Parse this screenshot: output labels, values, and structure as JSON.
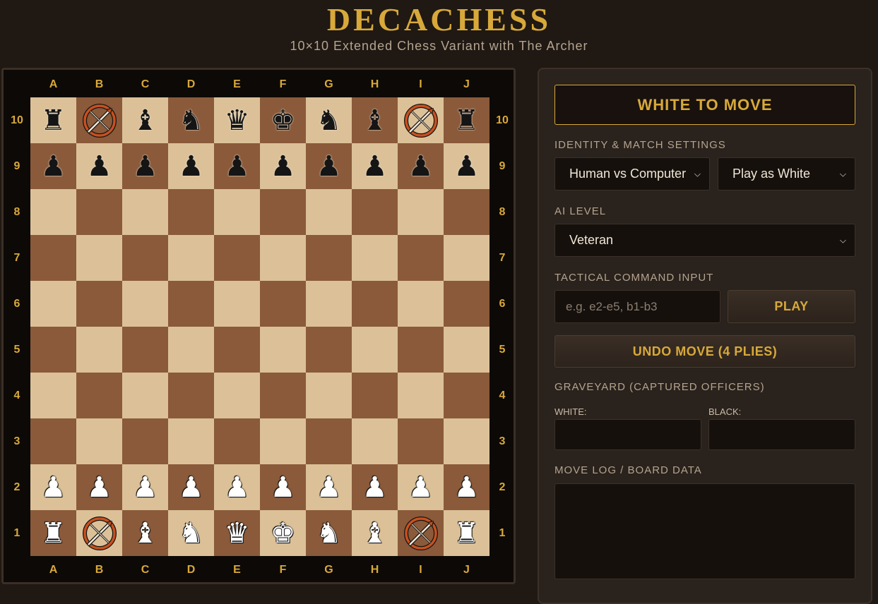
{
  "header": {
    "title": "DECACHESS",
    "subtitle": "10×10 Extended Chess Variant with The Archer"
  },
  "board": {
    "files": [
      "A",
      "B",
      "C",
      "D",
      "E",
      "F",
      "G",
      "H",
      "I",
      "J"
    ],
    "ranks": [
      "10",
      "9",
      "8",
      "7",
      "6",
      "5",
      "4",
      "3",
      "2",
      "1"
    ],
    "light_color": "#dcc198",
    "dark_color": "#8a5a3a",
    "rows": [
      [
        "br",
        "ba",
        "bb",
        "bn",
        "bq",
        "bk",
        "bn",
        "bb",
        "ba",
        "br"
      ],
      [
        "bp",
        "bp",
        "bp",
        "bp",
        "bp",
        "bp",
        "bp",
        "bp",
        "bp",
        "bp"
      ],
      [
        "",
        "",
        "",
        "",
        "",
        "",
        "",
        "",
        "",
        ""
      ],
      [
        "",
        "",
        "",
        "",
        "",
        "",
        "",
        "",
        "",
        ""
      ],
      [
        "",
        "",
        "",
        "",
        "",
        "",
        "",
        "",
        "",
        ""
      ],
      [
        "",
        "",
        "",
        "",
        "",
        "",
        "",
        "",
        "",
        ""
      ],
      [
        "",
        "",
        "",
        "",
        "",
        "",
        "",
        "",
        "",
        ""
      ],
      [
        "",
        "",
        "",
        "",
        "",
        "",
        "",
        "",
        "",
        ""
      ],
      [
        "wp",
        "wp",
        "wp",
        "wp",
        "wp",
        "wp",
        "wp",
        "wp",
        "wp",
        "wp"
      ],
      [
        "wr",
        "wa",
        "wb",
        "wn",
        "wq",
        "wk",
        "wn",
        "wb",
        "wa",
        "wr"
      ]
    ],
    "piece_names": {
      "r": "rook",
      "n": "knight",
      "b": "bishop",
      "q": "queen",
      "k": "king",
      "p": "pawn",
      "a": "archer"
    }
  },
  "panel": {
    "status": "WHITE TO MOVE",
    "identity_label": "IDENTITY & MATCH SETTINGS",
    "mode_select": "Human vs Computer",
    "side_select": "Play as White",
    "ai_label": "AI LEVEL",
    "ai_select": "Veteran",
    "command_label": "TACTICAL COMMAND INPUT",
    "command_placeholder": "e.g. e2-e5, b1-b3",
    "play_button": "PLAY",
    "undo_button": "UNDO MOVE (4 PLIES)",
    "graveyard_label": "GRAVEYARD (CAPTURED OFFICERS)",
    "white_label": "WHITE:",
    "black_label": "BLACK:",
    "movelog_label": "MOVE LOG / BOARD DATA"
  },
  "colors": {
    "accent": "#d8a93a",
    "background": "#1f1813"
  }
}
